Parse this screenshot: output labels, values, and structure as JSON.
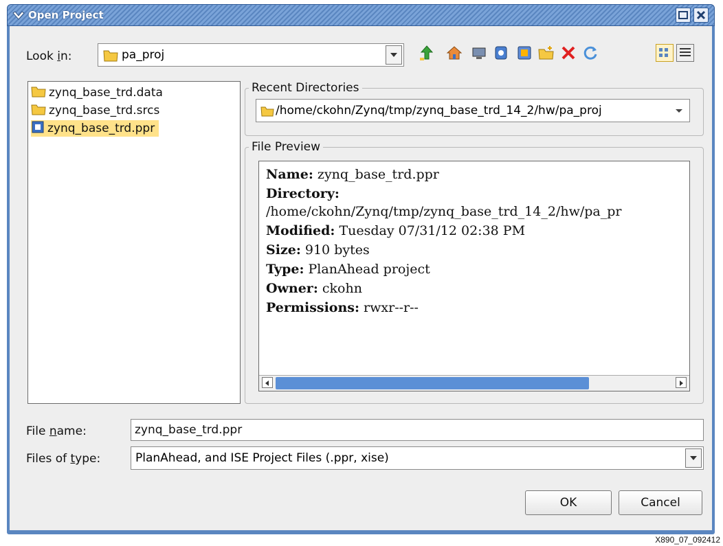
{
  "window": {
    "title": "Open Project"
  },
  "look_in": {
    "label_pre": "Look ",
    "label_mnemonic": "i",
    "label_post": "n:",
    "value": "pa_proj"
  },
  "toolbar": {
    "icons": [
      "up-folder-icon",
      "home-icon",
      "desktop-icon",
      "network-icon",
      "computer-icon",
      "new-folder-icon",
      "delete-icon",
      "refresh-icon",
      "list-view-icon",
      "details-view-icon"
    ]
  },
  "files": [
    {
      "name": "zynq_base_trd.data",
      "kind": "folder"
    },
    {
      "name": "zynq_base_trd.srcs",
      "kind": "folder"
    },
    {
      "name": "zynq_base_trd.ppr",
      "kind": "project",
      "selected": true
    }
  ],
  "recent": {
    "title": "Recent Directories",
    "value": "/home/ckohn/Zynq/tmp/zynq_base_trd_14_2/hw/pa_proj"
  },
  "preview": {
    "title": "File Preview",
    "name_label": "Name:",
    "name_value": " zynq_base_trd.ppr",
    "dir_label": "Directory:",
    "dir_value": "/home/ckohn/Zynq/tmp/zynq_base_trd_14_2/hw/pa_pr",
    "modified_label": "Modified:",
    "modified_value": " Tuesday 07/31/12 02:38 PM",
    "size_label": "Size:",
    "size_value": " 910 bytes",
    "type_label": "Type:",
    "type_value": " PlanAhead project",
    "owner_label": "Owner:",
    "owner_value": " ckohn",
    "perm_label": "Permissions:",
    "perm_value": " rwxr--r--"
  },
  "file_name": {
    "label_pre": "File ",
    "label_mnemonic": "n",
    "label_post": "ame:",
    "value": "zynq_base_trd.ppr"
  },
  "file_type": {
    "label_pre": "Files of ",
    "label_mnemonic": "t",
    "label_post": "ype:",
    "value": "PlanAhead, and ISE Project Files (.ppr, xise)"
  },
  "buttons": {
    "ok": "OK",
    "cancel": "Cancel"
  },
  "figure_code": "X890_07_092412",
  "colors": {
    "titlebar": "#5a86c0",
    "selection": "#ffe28a",
    "scroll_thumb": "#5b8fd6"
  }
}
